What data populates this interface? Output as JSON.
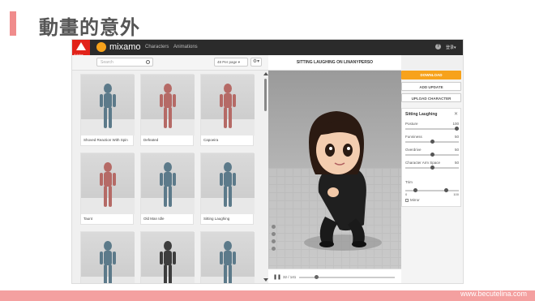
{
  "slide": {
    "title": "動畫的意外",
    "footer_url": "www.becutelina.com"
  },
  "app": {
    "brand": "mixamo",
    "adobe_label": "Adobe",
    "nav": [
      "Characters",
      "Animations"
    ],
    "help_icon": "help-icon",
    "user_menu": "登录▾"
  },
  "toolbar": {
    "search_placeholder": "Search",
    "per_page": "48 Per page ▾",
    "settings": "⚙▾"
  },
  "grid": {
    "cards": [
      {
        "label": "Shoved Reaction With Spin",
        "tint": "#5c7a8a"
      },
      {
        "label": "Defeated",
        "tint": "#b56a66"
      },
      {
        "label": "Capoeira",
        "tint": "#b56a66"
      },
      {
        "label": "Taunt",
        "tint": "#b56a66"
      },
      {
        "label": "Old Man Idle",
        "tint": "#5c7a8a"
      },
      {
        "label": "Sitting Laughing",
        "tint": "#5c7a8a"
      },
      {
        "label": "",
        "tint": "#5c7a8a"
      },
      {
        "label": "",
        "tint": "#3d3d3d"
      },
      {
        "label": "",
        "tint": "#5c7a8a"
      }
    ]
  },
  "viewport": {
    "title": "SITTING LAUGHING ON LINANYPERSO"
  },
  "timeline": {
    "play": "❚❚",
    "frame": "32 / 141",
    "position": 0.17
  },
  "panel": {
    "download": "DOWNLOAD",
    "add_update": "ADD UPDATE",
    "upload": "UPLOAD CHARACTER",
    "props_title": "Sitting Laughing",
    "close": "✕",
    "params": [
      {
        "name": "Posture",
        "value": "100",
        "level": 1.0
      },
      {
        "name": "Funniness",
        "value": "50",
        "level": 0.5
      },
      {
        "name": "Overdrive",
        "value": "50",
        "level": 0.5
      },
      {
        "name": "Character Arm Space",
        "value": "50",
        "level": 0.5
      }
    ],
    "trim_label": "Trim",
    "trim_start": "0",
    "trim_end": "100",
    "mirror": "Mirror"
  },
  "colors": {
    "accent": "#f7a21b",
    "topbar": "#2b2b2b",
    "adobe_red": "#e2231a",
    "slide_accent": "#f08c8c"
  }
}
